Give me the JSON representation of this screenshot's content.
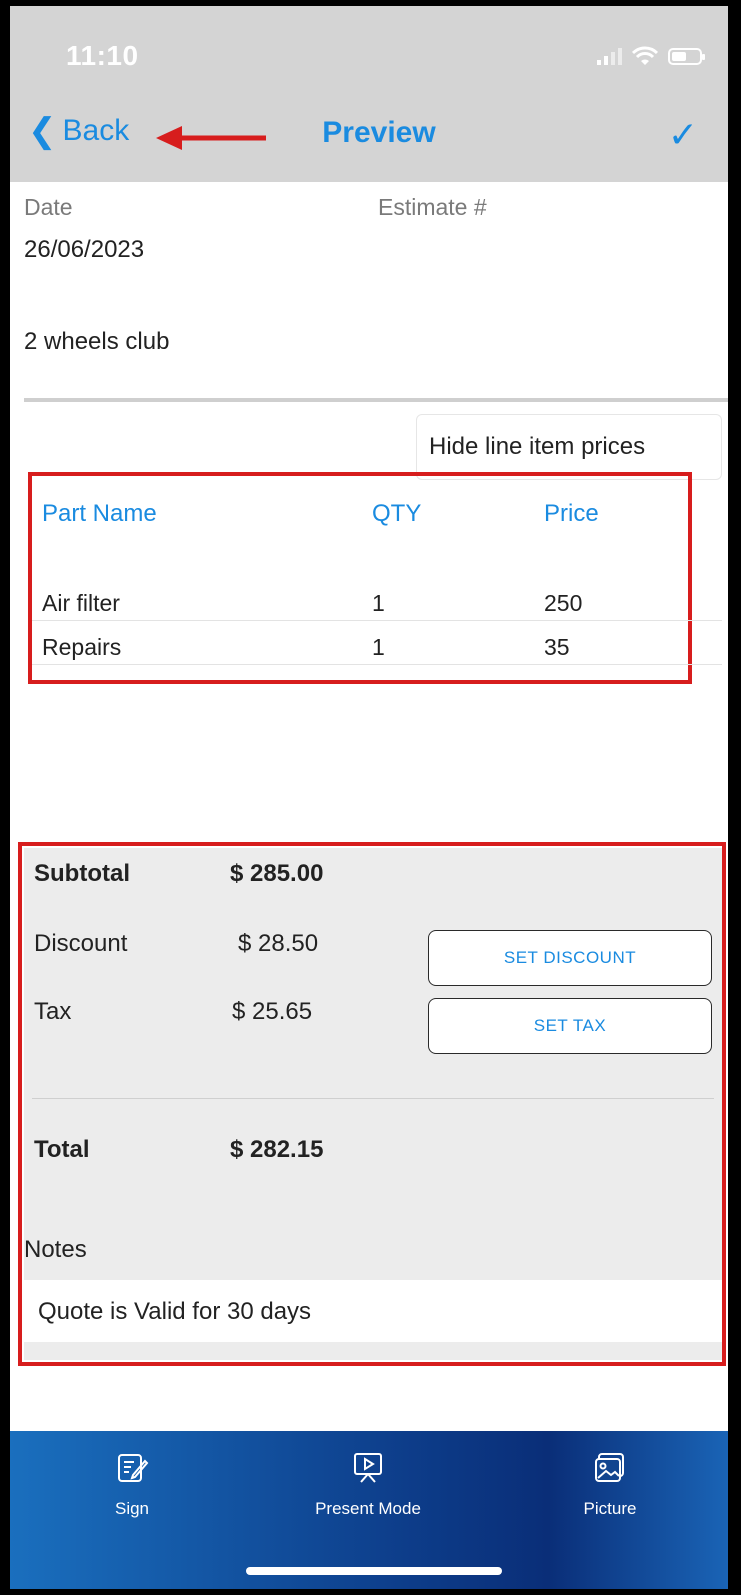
{
  "status": {
    "time": "11:10"
  },
  "nav": {
    "back_label": "Back",
    "title": "Preview",
    "confirm_icon": "checkmark-icon"
  },
  "estimate": {
    "date_label": "Date",
    "date_value": "26/06/2023",
    "estimate_label": "Estimate #",
    "customer": "2 wheels club"
  },
  "hide_prices_label": "Hide line item prices",
  "table": {
    "headers": [
      "Part Name",
      "QTY",
      "Price"
    ],
    "rows": [
      {
        "name": "Air filter",
        "qty": "1",
        "price": "250"
      },
      {
        "name": "Repairs",
        "qty": "1",
        "price": "35"
      }
    ]
  },
  "summary": {
    "subtotal_label": "Subtotal",
    "subtotal_value": "$  285.00",
    "discount_label": "Discount",
    "discount_value": "$ 28.50",
    "tax_label": "Tax",
    "tax_value": "$ 25.65",
    "set_discount_label": "SET DISCOUNT",
    "set_tax_label": "SET TAX",
    "total_label": "Total",
    "total_value": "$  282.15"
  },
  "notes": {
    "label": "Notes",
    "value": "Quote is Valid for 30 days"
  },
  "tabbar": {
    "items": [
      {
        "label": "Sign",
        "icon": "sign-icon"
      },
      {
        "label": "Present Mode",
        "icon": "present-icon"
      },
      {
        "label": "Picture",
        "icon": "picture-icon"
      }
    ]
  },
  "colors": {
    "accent": "#1a8be0",
    "annotation": "#d71d1d",
    "tabbar": "#0d3d8a"
  }
}
